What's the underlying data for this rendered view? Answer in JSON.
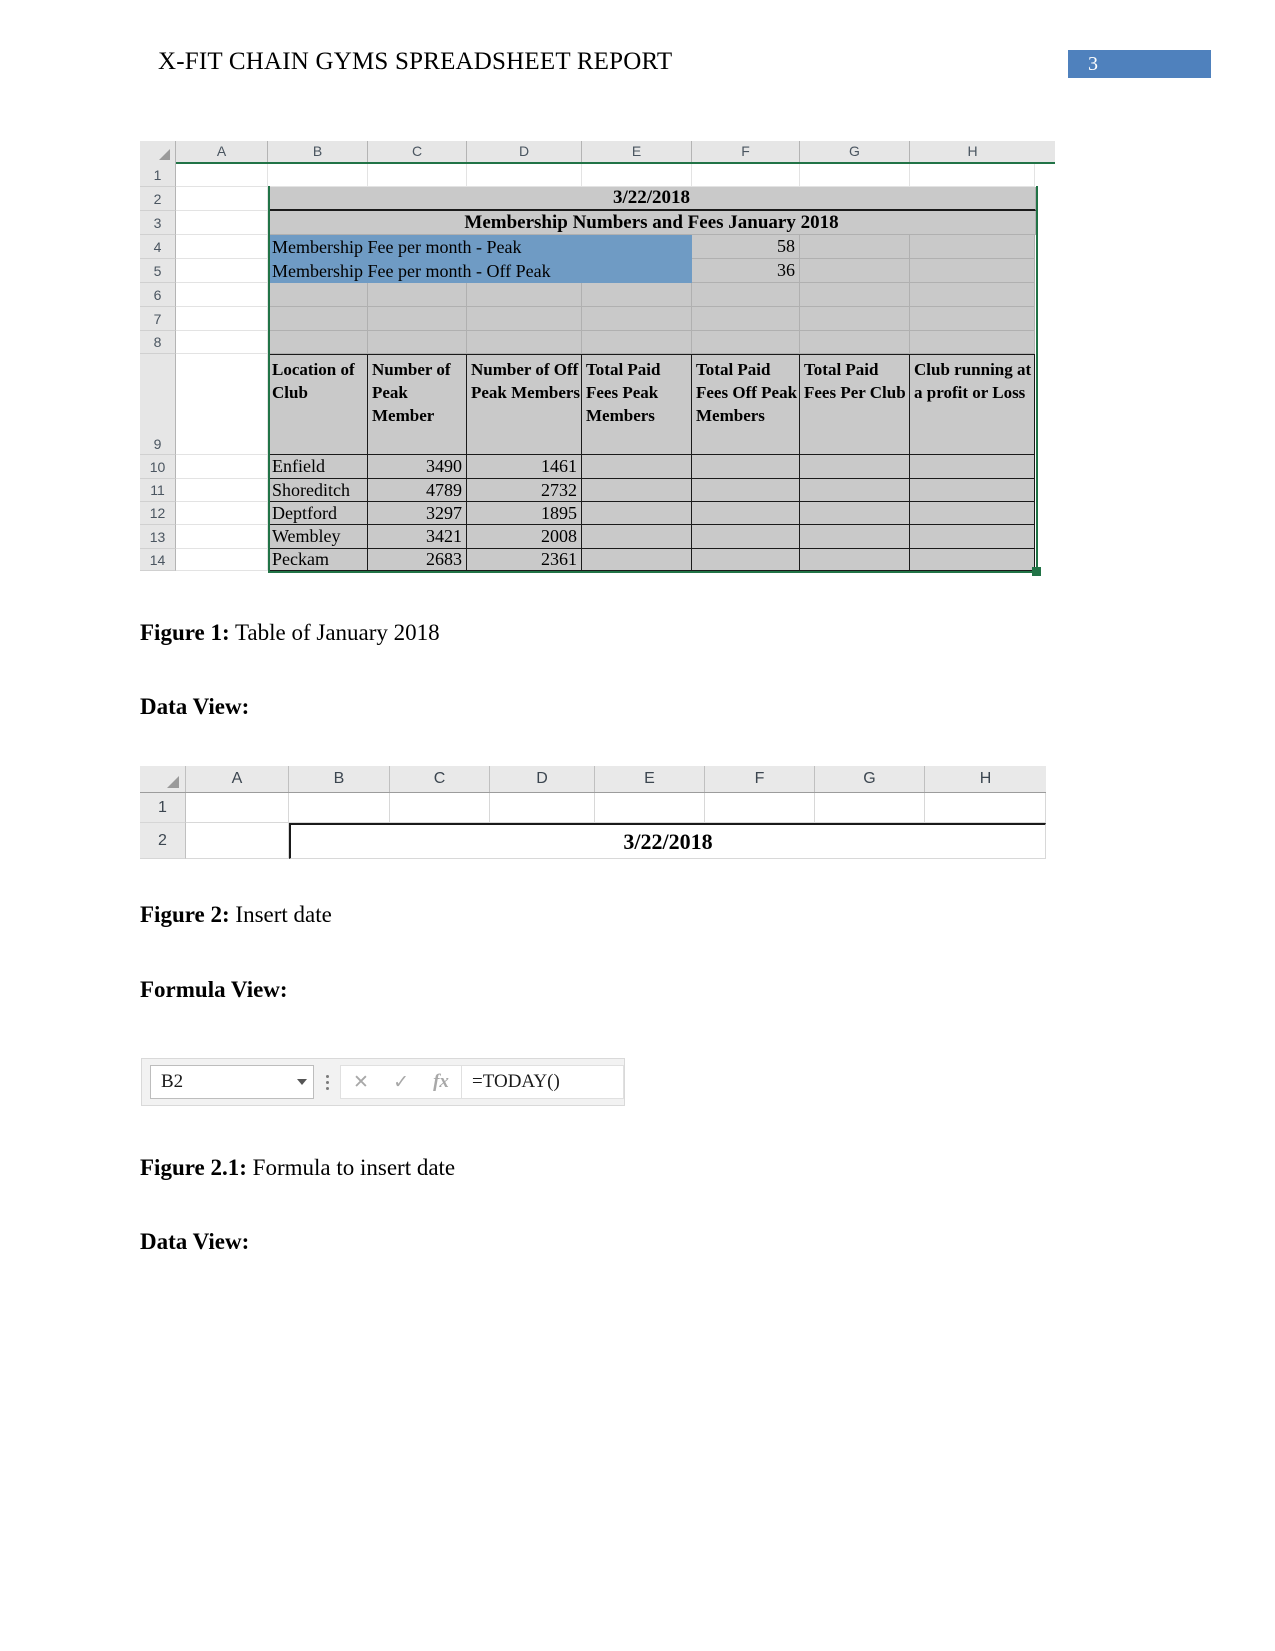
{
  "header": {
    "title": "X-FIT CHAIN GYMS SPREADSHEET REPORT",
    "page_number": "3",
    "badge_color": "#4f81bd"
  },
  "figure1": {
    "column_headers": [
      "A",
      "B",
      "C",
      "D",
      "E",
      "F",
      "G",
      "H"
    ],
    "row_numbers": [
      "1",
      "2",
      "3",
      "4",
      "5",
      "6",
      "7",
      "8",
      "9",
      "10",
      "11",
      "12",
      "13",
      "14"
    ],
    "date_cell": "3/22/2018",
    "table_title": "Membership Numbers and Fees January 2018",
    "fee_peak_label": "Membership Fee per month - Peak",
    "fee_peak_value": "58",
    "fee_offpeak_label": "Membership Fee per month - Off Peak",
    "fee_offpeak_value": "36",
    "headers": [
      "Location of Club",
      "Number of Peak Member",
      "Number of Off Peak Members",
      "Total Paid Fees Peak Members",
      "Total Paid Fees Off Peak Members",
      "Total Paid Fees Per Club",
      "Club running at a profit or Loss"
    ],
    "rows": [
      {
        "location": "Enfield",
        "peak": "3490",
        "offpeak": "1461",
        "fees_peak": "",
        "fees_offpeak": "",
        "fees_club": "",
        "profit_loss": ""
      },
      {
        "location": "Shoreditch",
        "peak": "4789",
        "offpeak": "2732",
        "fees_peak": "",
        "fees_offpeak": "",
        "fees_club": "",
        "profit_loss": ""
      },
      {
        "location": "Deptford",
        "peak": "3297",
        "offpeak": "1895",
        "fees_peak": "",
        "fees_offpeak": "",
        "fees_club": "",
        "profit_loss": ""
      },
      {
        "location": "Wembley",
        "peak": "3421",
        "offpeak": "2008",
        "fees_peak": "",
        "fees_offpeak": "",
        "fees_club": "",
        "profit_loss": ""
      },
      {
        "location": "Peckam",
        "peak": "2683",
        "offpeak": "2361",
        "fees_peak": "",
        "fees_offpeak": "",
        "fees_club": "",
        "profit_loss": ""
      }
    ],
    "caption_label": "Figure 1:",
    "caption_text": " Table of January 2018"
  },
  "section_data_view_1": "Data View:",
  "figure2": {
    "column_headers": [
      "A",
      "B",
      "C",
      "D",
      "E",
      "F",
      "G",
      "H"
    ],
    "row_numbers": [
      "1",
      "2"
    ],
    "date_cell": "3/22/2018",
    "caption_label": "Figure 2:",
    "caption_text": " Insert date"
  },
  "section_formula_view": "Formula View:",
  "formula_bar": {
    "name_box_value": "B2",
    "dropdown_icon": "chevron-down-icon",
    "cancel_icon": "✕",
    "enter_icon": "✓",
    "function_icon": "fx",
    "formula_value": "=TODAY()",
    "caption_label": "Figure 2.1:",
    "caption_text": " Formula to insert date"
  },
  "section_data_view_2": "Data View:"
}
